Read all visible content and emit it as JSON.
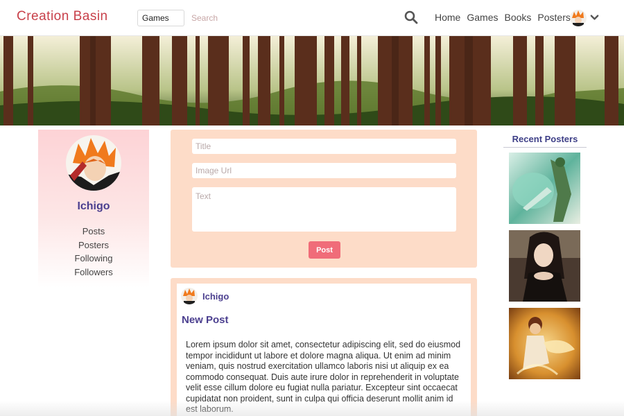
{
  "brand": {
    "title": "Creation Basin",
    "color": "#c8404a"
  },
  "search": {
    "category_value": "Games",
    "placeholder": "Search",
    "icon": "search-icon"
  },
  "nav": {
    "links": [
      "Home",
      "Games",
      "Books",
      "Posters"
    ],
    "menu_icon": "chevron-down-icon"
  },
  "hero": {
    "scene": "redwood forest banner"
  },
  "profile": {
    "name": "Ichigo",
    "menu": [
      "Posts",
      "Posters",
      "Following",
      "Followers"
    ]
  },
  "post_form": {
    "title_placeholder": "Title",
    "image_placeholder": "Image Url",
    "text_placeholder": "Text",
    "submit_label": "Post"
  },
  "feed": {
    "author": "Ichigo",
    "title": "New Post",
    "body": "Lorem ipsum dolor sit amet, consectetur adipiscing elit, sed do eiusmod tempor incididunt ut labore et dolore magna aliqua. Ut enim ad minim veniam, quis nostrud exercitation ullamco laboris nisi ut aliquip ex ea commodo consequat. Duis aute irure dolor in reprehenderit in voluptate velit esse cillum dolore eu fugiat nulla pariatur. Excepteur sint occaecat cupidatat non proident, sunt in culpa qui officia deserunt mollit anim id est laborum."
  },
  "sidebar": {
    "heading": "Recent Posters"
  },
  "colors": {
    "accent": "#4b3f8f",
    "panel": "#fddcc8",
    "button": "#f06c79",
    "profile_gradient_top": "#fdd3d6"
  }
}
